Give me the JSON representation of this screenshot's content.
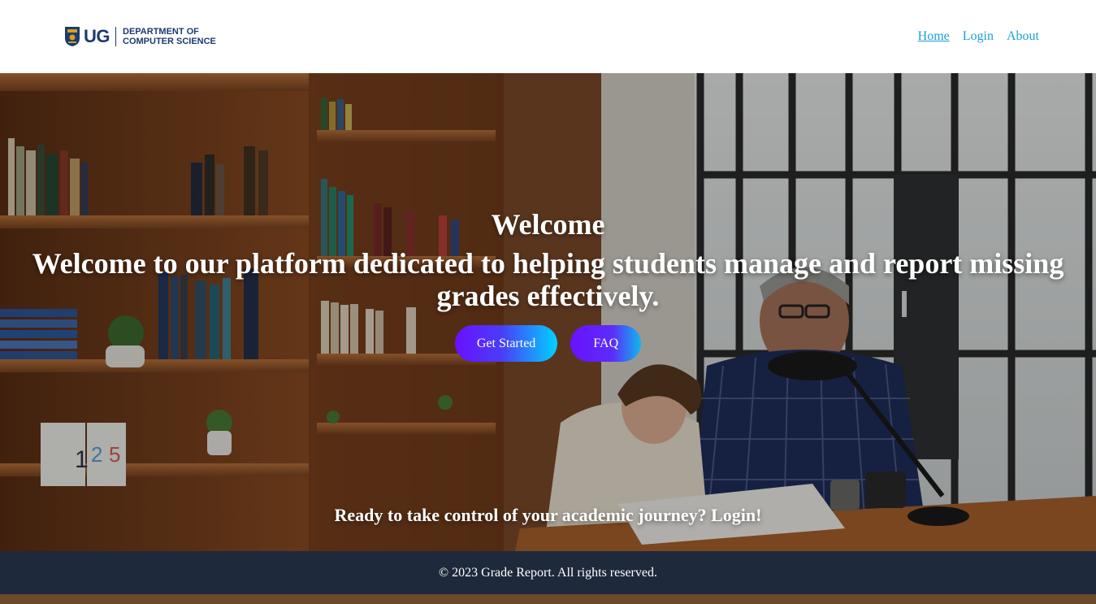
{
  "brand": {
    "logo_mark": "UG",
    "logo_line1": "DEPARTMENT OF",
    "logo_line2": "COMPUTER SCIENCE"
  },
  "nav": {
    "items": [
      {
        "label": "Home",
        "active": true
      },
      {
        "label": "Login",
        "active": false
      },
      {
        "label": "About",
        "active": false
      }
    ]
  },
  "hero": {
    "title": "Welcome",
    "subtitle": "Welcome to our platform dedicated to helping students manage and report missing grades effectively.",
    "buttons": {
      "get_started": "Get Started",
      "faq": "FAQ"
    },
    "cta": "Ready to take control of your academic journey? Login!",
    "background_image": "photo of a student studying at a desk with a teacher beside him, bookshelves behind"
  },
  "footer": {
    "text": "© 2023 Grade Report. All rights reserved."
  },
  "colors": {
    "nav_link": "#1a9ed8",
    "brand_navy": "#1c3a6e",
    "footer_bg": "#1e293b",
    "button_gradient_start": "#6a11ff",
    "button_gradient_end": "#00d2ff"
  }
}
